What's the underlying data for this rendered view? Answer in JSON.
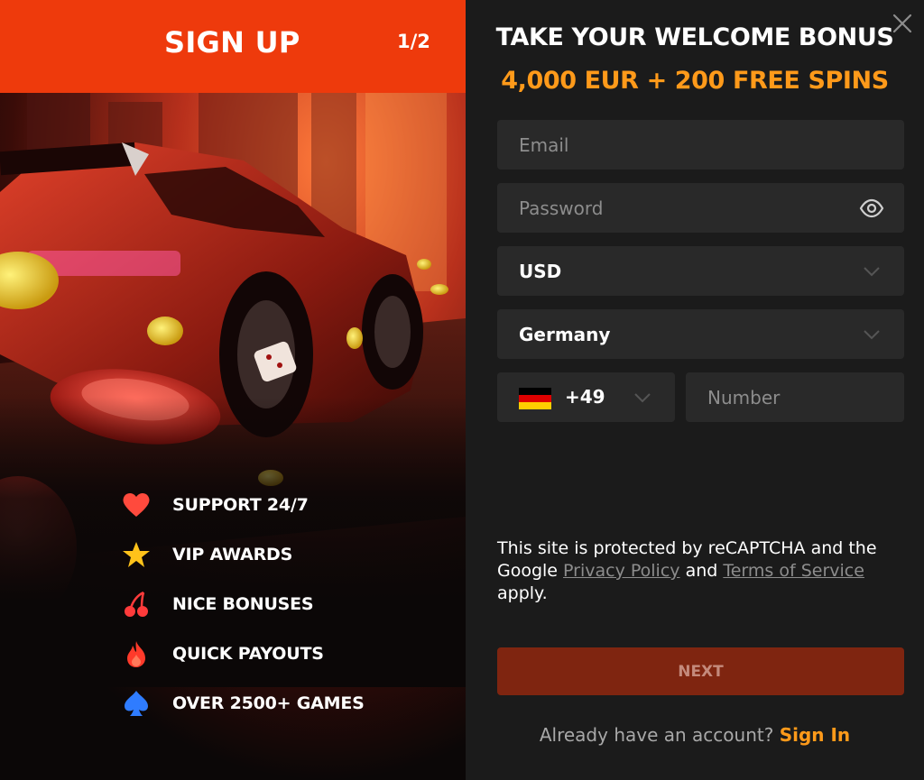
{
  "signup": {
    "title": "SIGN UP",
    "step": "1/2"
  },
  "features": [
    {
      "icon": "heart-icon",
      "label": "SUPPORT 24/7",
      "color": "#ff4a3d"
    },
    {
      "icon": "star-icon",
      "label": "VIP AWARDS",
      "color": "#ffc21a"
    },
    {
      "icon": "cherries-icon",
      "label": "NICE BONUSES",
      "color": "#ff3b3b"
    },
    {
      "icon": "flame-icon",
      "label": "QUICK PAYOUTS",
      "color": "#ff3a2a"
    },
    {
      "icon": "spade-icon",
      "label": "OVER 2500+ GAMES",
      "color": "#2f7cff"
    }
  ],
  "bonus": {
    "title": "TAKE YOUR WELCOME BONUS",
    "subtitle": "4,000 EUR + 200 FREE SPINS"
  },
  "form": {
    "email_placeholder": "Email",
    "password_placeholder": "Password",
    "currency_value": "USD",
    "country_value": "Germany",
    "phone_code": "+49",
    "phone_placeholder": "Number"
  },
  "recaptcha": {
    "text_1": "This site is protected by reCAPTCHA and the Google ",
    "privacy_link": "Privacy Policy",
    "and": " and ",
    "terms_link": "Terms of Service",
    "text_2": " apply."
  },
  "next_label": "NEXT",
  "signin": {
    "question": "Already have an account? ",
    "link": "Sign In"
  },
  "colors": {
    "header_accent": "#ee3a0c",
    "bonus_accent": "#ff9a1a",
    "next_button": "#7f2510"
  }
}
